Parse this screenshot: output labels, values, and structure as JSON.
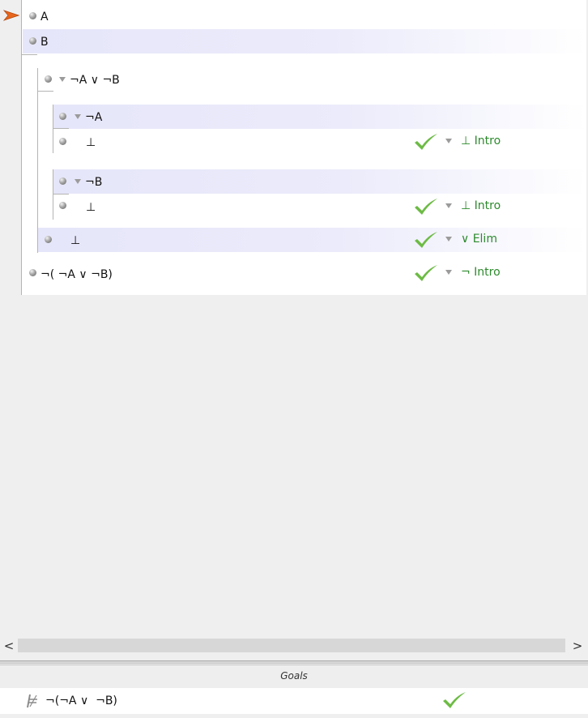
{
  "proof": {
    "premise_a": "A",
    "premise_b": "B",
    "assumption_disj": "¬A ∨ ¬B",
    "assumption_not_a": "¬A",
    "bottom_1": "⊥",
    "rule_1": "⊥ Intro",
    "assumption_not_b": "¬B",
    "bottom_2": "⊥",
    "rule_2": "⊥ Intro",
    "bottom_3": "⊥",
    "rule_3": "∨ Elim",
    "conclusion": "¬( ¬A ∨ ¬B)",
    "rule_4": "¬ Intro"
  },
  "scrollbar": {
    "left_arrow": "<",
    "right_arrow": ">"
  },
  "goals": {
    "header": "Goals",
    "goal_formula": "¬(¬A ∨  ¬B)"
  },
  "colors": {
    "rule_green": "#2d8a2d",
    "check_green": "#6dbb45",
    "pointer_orange": "#e8651c",
    "selection_band": "#e6e6fa"
  },
  "icons": [
    "pointer-arrow-icon",
    "bullet-icon",
    "collapse-triangle-icon",
    "checkmark-icon",
    "turnstile-icon"
  ]
}
